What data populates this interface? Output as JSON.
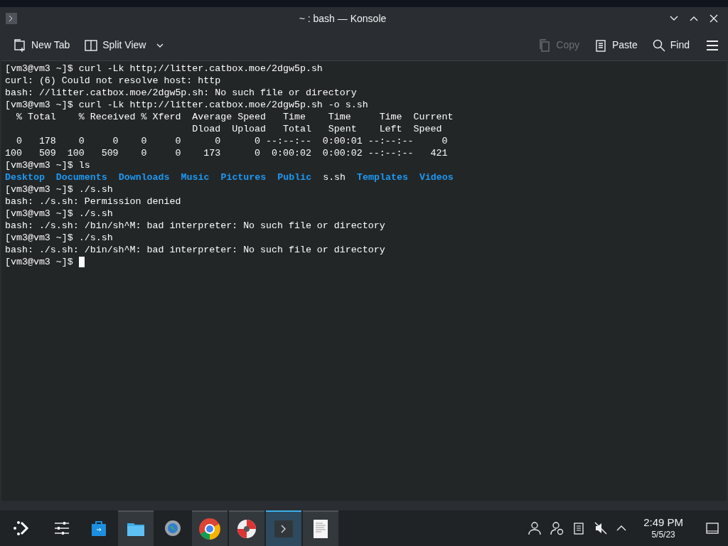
{
  "window": {
    "title": "~ : bash — Konsole"
  },
  "toolbar": {
    "left": [
      {
        "kind": "new-tab",
        "label": "New Tab",
        "disabled": false
      },
      {
        "kind": "split",
        "label": "Split View",
        "disabled": false
      }
    ],
    "right": [
      {
        "kind": "copy",
        "label": "Copy",
        "disabled": true
      },
      {
        "kind": "paste",
        "label": "Paste",
        "disabled": false
      },
      {
        "kind": "find",
        "label": "Find",
        "disabled": false
      }
    ]
  },
  "terminal": {
    "lines": [
      {
        "kind": "text",
        "text": "[vm3@vm3 ~]$ curl -Lk http;//litter.catbox.moe/2dgw5p.sh"
      },
      {
        "kind": "text",
        "text": "curl: (6) Could not resolve host: http"
      },
      {
        "kind": "text",
        "text": "bash: //litter.catbox.moe/2dgw5p.sh: No such file or directory"
      },
      {
        "kind": "text",
        "text": "[vm3@vm3 ~]$ curl -Lk http://litter.catbox.moe/2dgw5p.sh -o s.sh"
      },
      {
        "kind": "text",
        "text": "  % Total    % Received % Xferd  Average Speed   Time    Time     Time  Current"
      },
      {
        "kind": "text",
        "text": "                                 Dload  Upload   Total   Spent    Left  Speed"
      },
      {
        "kind": "text",
        "text": "  0   178    0     0    0     0      0      0 --:--:--  0:00:01 --:--:--     0"
      },
      {
        "kind": "text",
        "text": "100   509  100   509    0     0    173      0  0:00:02  0:00:02 --:--:--   421"
      },
      {
        "kind": "text",
        "text": "[vm3@vm3 ~]$ ls"
      },
      {
        "kind": "listing",
        "entries": [
          {
            "name": "Desktop",
            "kind": "dir"
          },
          {
            "name": "Documents",
            "kind": "dir"
          },
          {
            "name": "Downloads",
            "kind": "dir"
          },
          {
            "name": "Music",
            "kind": "dir"
          },
          {
            "name": "Pictures",
            "kind": "dir"
          },
          {
            "name": "Public",
            "kind": "dir"
          },
          {
            "name": "s.sh",
            "kind": "file"
          },
          {
            "name": "Templates",
            "kind": "dir"
          },
          {
            "name": "Videos",
            "kind": "dir"
          }
        ]
      },
      {
        "kind": "text",
        "text": "[vm3@vm3 ~]$ ./s.sh"
      },
      {
        "kind": "text",
        "text": "bash: ./s.sh: Permission denied"
      },
      {
        "kind": "text",
        "text": "[vm3@vm3 ~]$ ./s.sh"
      },
      {
        "kind": "text",
        "text": "bash: ./s.sh: /bin/sh^M: bad interpreter: No such file or directory"
      },
      {
        "kind": "text",
        "text": "[vm3@vm3 ~]$ ./s.sh"
      },
      {
        "kind": "text",
        "text": "bash: ./s.sh: /bin/sh^M: bad interpreter: No such file or directory"
      },
      {
        "kind": "prompt",
        "text": "[vm3@vm3 ~]$ "
      }
    ]
  },
  "taskbar": {
    "tasks": [
      {
        "kind": "overview",
        "open": false,
        "selected": false
      },
      {
        "kind": "panel",
        "open": false,
        "selected": false
      },
      {
        "kind": "store",
        "open": false,
        "selected": false
      },
      {
        "kind": "files",
        "open": true,
        "selected": false
      },
      {
        "kind": "settings",
        "open": false,
        "selected": false
      },
      {
        "kind": "browser",
        "open": true,
        "selected": false
      },
      {
        "kind": "disc",
        "open": true,
        "selected": false
      },
      {
        "kind": "terminal",
        "open": true,
        "selected": true
      },
      {
        "kind": "document",
        "open": true,
        "selected": false
      }
    ],
    "clock": {
      "time": "2:49 PM",
      "date": "5/5/23"
    }
  }
}
